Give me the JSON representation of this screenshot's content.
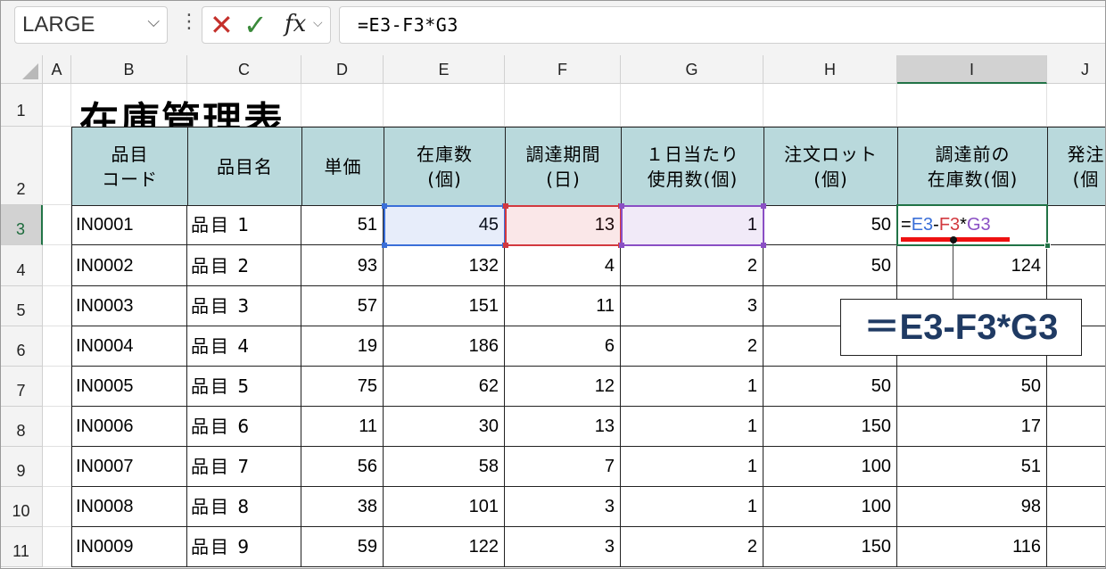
{
  "formula_bar": {
    "name_box": "LARGE",
    "name_box_chevron": "⌵",
    "more_dots": "⋮",
    "cancel_glyph": "✕",
    "enter_glyph": "✓",
    "fx_label": "fx",
    "fx_chevron": "⌵",
    "formula": "=E3-F3*G3"
  },
  "columns": [
    "A",
    "B",
    "C",
    "D",
    "E",
    "F",
    "G",
    "H",
    "I",
    "J"
  ],
  "rows": [
    "1",
    "2",
    "3",
    "4",
    "5",
    "6",
    "7",
    "8",
    "9",
    "10",
    "11"
  ],
  "selected_column": "I",
  "selected_row": "3",
  "sheet_title": "在庫管理表",
  "table": {
    "headers": [
      "品目\nコード",
      "品目名",
      "単価",
      "在庫数\n(個)",
      "調達期間\n(日)",
      "１日当たり\n使用数(個)",
      "注文ロット\n(個)",
      "調達前の\n在庫数(個)",
      "発注\n(個"
    ],
    "rows": [
      {
        "code": "IN0001",
        "name": "品目 1",
        "price": "51",
        "stock": "45",
        "lead": "13",
        "use": "1",
        "lot": "50",
        "pre": ""
      },
      {
        "code": "IN0002",
        "name": "品目 2",
        "price": "93",
        "stock": "132",
        "lead": "4",
        "use": "2",
        "lot": "50",
        "pre": "124"
      },
      {
        "code": "IN0003",
        "name": "品目 3",
        "price": "57",
        "stock": "151",
        "lead": "11",
        "use": "3",
        "lot": "",
        "pre": ""
      },
      {
        "code": "IN0004",
        "name": "品目 4",
        "price": "19",
        "stock": "186",
        "lead": "6",
        "use": "2",
        "lot": "",
        "pre": ""
      },
      {
        "code": "IN0005",
        "name": "品目 5",
        "price": "75",
        "stock": "62",
        "lead": "12",
        "use": "1",
        "lot": "50",
        "pre": "50"
      },
      {
        "code": "IN0006",
        "name": "品目 6",
        "price": "11",
        "stock": "30",
        "lead": "13",
        "use": "1",
        "lot": "150",
        "pre": "17"
      },
      {
        "code": "IN0007",
        "name": "品目 7",
        "price": "56",
        "stock": "58",
        "lead": "7",
        "use": "1",
        "lot": "100",
        "pre": "51"
      },
      {
        "code": "IN0008",
        "name": "品目 8",
        "price": "38",
        "stock": "101",
        "lead": "3",
        "use": "1",
        "lot": "100",
        "pre": "98"
      },
      {
        "code": "IN0009",
        "name": "品目 9",
        "price": "59",
        "stock": "122",
        "lead": "3",
        "use": "2",
        "lot": "150",
        "pre": "116"
      }
    ]
  },
  "editing_formula": {
    "eq": "=",
    "ref1": "E3",
    "op1": "-",
    "ref2": "F3",
    "op2": "*",
    "ref3": "G3"
  },
  "callout_text": "＝E3-F3*G3",
  "colors": {
    "header_fill": "#b9d9dc",
    "ref_blue": "#3a6fd8",
    "ref_red": "#d2393f",
    "ref_purple": "#8a4fc4",
    "excel_green": "#217346",
    "underline_red": "#ee1111",
    "callout_text": "#1f3a63"
  }
}
